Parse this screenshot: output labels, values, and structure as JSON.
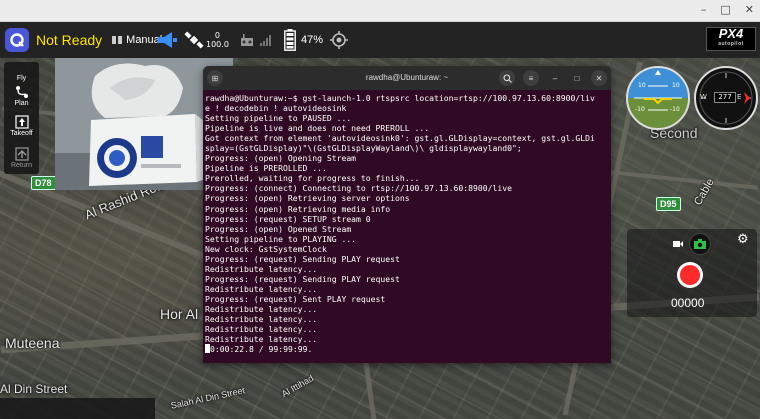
{
  "toolbar": {
    "status": "Not Ready",
    "flight_mode": "Manual",
    "satellite_count": "0",
    "hdop": "100.0",
    "battery_percent": "47%"
  },
  "brand": {
    "logo_main": "PX4",
    "logo_sub": "autopilot"
  },
  "tools": [
    {
      "label": "Fly"
    },
    {
      "label": "Plan"
    },
    {
      "label": "Takeoff"
    },
    {
      "label": "Return"
    }
  ],
  "terminal": {
    "title": "rawdha@Ubunturaw: ~",
    "lines": [
      "rawdha@Ubunturaw:~$ gst-launch-1.0 rtspsrc location=rtsp://100.97.13.60:8900/liv",
      "e ! decodebin ! autovideosink",
      "Setting pipeline to PAUSED ...",
      "Pipeline is live and does not need PREROLL ...",
      "Got context from element 'autovideosink0': gst.gl.GLDisplay=context, gst.gl.GLDi",
      "splay=(GstGLDisplay)\"\\(GstGLDisplayWayland\\)\\ gldisplaywayland0\";",
      "Progress: (open) Opening Stream",
      "Pipeline is PREROLLED ...",
      "Prerolled, waiting for progress to finish...",
      "Progress: (connect) Connecting to rtsp://100.97.13.60:8900/live",
      "Progress: (open) Retrieving server options",
      "Progress: (open) Retrieving media info",
      "Progress: (request) SETUP stream 0",
      "Progress: (open) Opened Stream",
      "Setting pipeline to PLAYING ...",
      "New clock: GstSystemClock",
      "Progress: (request) Sending PLAY request",
      "Redistribute latency...",
      "Progress: (request) Sending PLAY request",
      "Redistribute latency...",
      "Progress: (request) Sent PLAY request",
      "Redistribute latency...",
      "Redistribute latency...",
      "Redistribute latency...",
      "Redistribute latency...",
      "0:00:22.8 / 99:99:99."
    ]
  },
  "map": {
    "labels": [
      {
        "text": "Al Rashid Road"
      },
      {
        "text": "Hor Al"
      },
      {
        "text": "Muteena"
      },
      {
        "text": "Al Din Street"
      },
      {
        "text": "Salah Al Din Street"
      },
      {
        "text": "Second"
      },
      {
        "text": "Al Ittihad"
      },
      {
        "text": "Cable"
      }
    ],
    "signs": [
      "D78",
      "D95"
    ]
  },
  "attitude": {
    "pitch_up": "10",
    "pitch_down": "-10"
  },
  "compass": {
    "heading": "277",
    "west": "W",
    "east": "E"
  },
  "camera": {
    "counter": "00000"
  },
  "colors": {
    "status_yellow": "#ffe600",
    "toolbar_bg": "#232323",
    "terminal_bg": "#300a24",
    "record_red": "#ff2a2a",
    "camera_green": "#2fbf4a"
  }
}
